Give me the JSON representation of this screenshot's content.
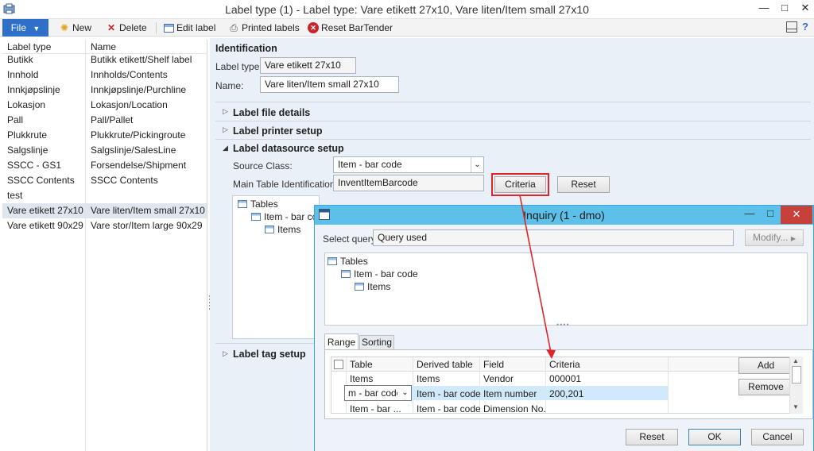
{
  "window": {
    "title": "Label type (1) - Label type: Vare etikett 27x10, Vare liten/Item small 27x10",
    "minimize_glyph": "—",
    "maximize_glyph": "□",
    "close_glyph": "✕"
  },
  "toolbar": {
    "file_label": "File",
    "new_label": "New",
    "delete_label": "Delete",
    "edit_label": "Edit label",
    "printed_label": "Printed labels",
    "reset_label": "Reset BarTender"
  },
  "list": {
    "headers": [
      "Label type",
      "Name"
    ],
    "rows": [
      {
        "type": "Butikk",
        "name": "Butikk etikett/Shelf label"
      },
      {
        "type": "Innhold",
        "name": "Innholds/Contents"
      },
      {
        "type": "Innkjøpslinje",
        "name": "Innkjøpslinje/Purchline"
      },
      {
        "type": "Lokasjon",
        "name": "Lokasjon/Location"
      },
      {
        "type": "Pall",
        "name": "Pall/Pallet"
      },
      {
        "type": "Plukkrute",
        "name": "Plukkrute/Pickingroute"
      },
      {
        "type": "Salgslinje",
        "name": "Salgslinje/SalesLine"
      },
      {
        "type": "SSCC - GS1",
        "name": "Forsendelse/Shipment"
      },
      {
        "type": "SSCC Contents",
        "name": "SSCC Contents"
      },
      {
        "type": "test",
        "name": ""
      },
      {
        "type": "Vare etikett 27x10",
        "name": "Vare liten/Item small 27x10"
      },
      {
        "type": "Vare etikett 90x29",
        "name": "Vare stor/Item large 90x29"
      }
    ]
  },
  "detail": {
    "identification": "Identification",
    "label_type_label": "Label type:",
    "label_type_value": "Vare etikett 27x10",
    "name_label": "Name:",
    "name_value": "Vare liten/Item small 27x10",
    "sec_file": "Label file details",
    "sec_printer": "Label printer setup",
    "sec_datasource": "Label datasource setup",
    "source_class_label": "Source Class:",
    "source_class_value": "Item - bar code",
    "main_table_label": "Main Table Identification:",
    "main_table_value": "InventItemBarcode",
    "criteria_btn": "Criteria",
    "reset_btn": "Reset",
    "tree": [
      "Tables",
      "Item - bar co",
      "Items"
    ],
    "sec_tag": "Label tag setup"
  },
  "dialog": {
    "title": "Inquiry (1 - dmo)",
    "select_query_label": "Select query:",
    "select_query_value": "Query used",
    "modify_btn": "Modify...",
    "tree": [
      "Tables",
      "Item - bar code",
      "Items"
    ],
    "tabs": [
      "Range",
      "Sorting"
    ],
    "grid_headers": [
      "Table",
      "Derived table",
      "Field",
      "Criteria"
    ],
    "grid_rows": [
      {
        "table": "Items",
        "derived": "Items",
        "field": "Vendor",
        "criteria": "000001"
      },
      {
        "table": "m - bar code",
        "derived": "Item - bar code",
        "field": "Item number",
        "criteria": "200,201"
      },
      {
        "table": "Item - bar ...",
        "derived": "Item - bar code",
        "field": "Dimension No.",
        "criteria": ""
      }
    ],
    "add_btn": "Add",
    "remove_btn": "Remove",
    "reset_btn": "Reset",
    "ok_btn": "OK",
    "cancel_btn": "Cancel"
  },
  "colors": {
    "accent": "#2d6fc9",
    "dialog_title": "#5cc0e8",
    "highlight": "#d0e9fb",
    "annotation": "#e0262a"
  }
}
